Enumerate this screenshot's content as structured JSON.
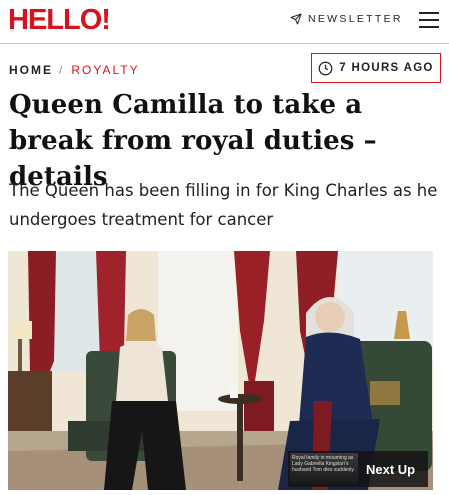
{
  "header": {
    "logo": "HELLO!",
    "newsletter_label": "NEWSLETTER",
    "icons": [
      "paper-plane-icon",
      "hamburger-menu-icon"
    ]
  },
  "breadcrumb": {
    "home": "HOME",
    "separator": "/",
    "category": "ROYALTY"
  },
  "timestamp": "7 HOURS AGO",
  "headline": "Queen Camilla to take a break from royal duties – details",
  "standfirst": "The Queen has been filling in for King Charles as he undergoes treatment for cancer",
  "next_up": {
    "label": "Next Up",
    "thumb_text": "Royal family in mourning as Lady Gabriella Kingston's husband Tom dies suddenly"
  },
  "colors": {
    "brand": "#d8121c",
    "text": "#111111"
  }
}
